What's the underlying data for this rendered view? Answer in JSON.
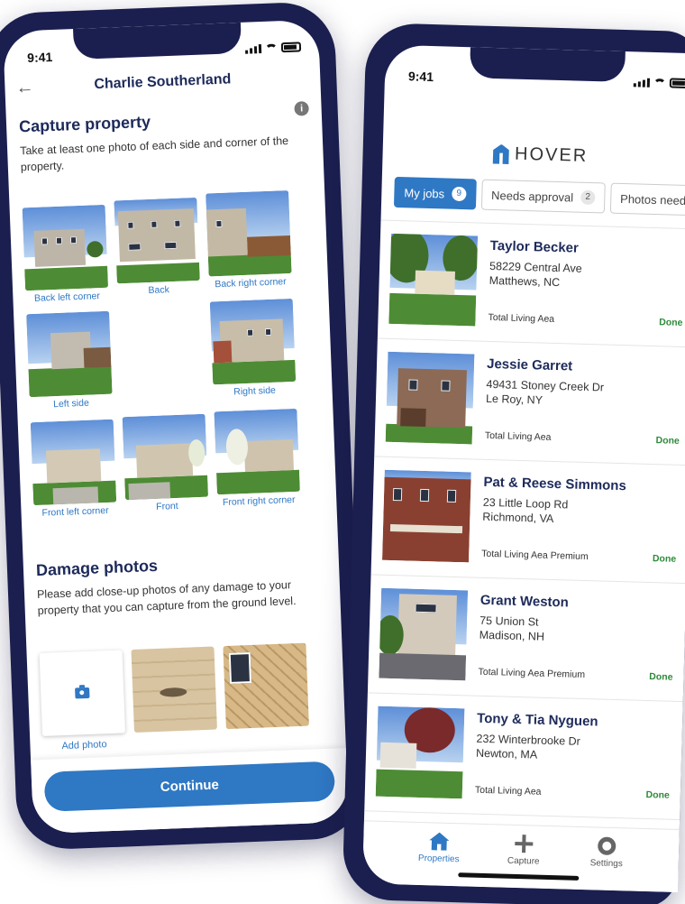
{
  "left_phone": {
    "status_time": "9:41",
    "header_name": "Charlie Southerland",
    "capture": {
      "title": "Capture property",
      "description": "Take at least one photo of each side and corner of the property.",
      "photos": [
        {
          "label": "Back left corner"
        },
        {
          "label": "Back"
        },
        {
          "label": "Back right corner"
        },
        {
          "label": "Left side"
        },
        {
          "label": "Right side"
        },
        {
          "label": "Front left corner"
        },
        {
          "label": "Front"
        },
        {
          "label": "Front right corner"
        }
      ]
    },
    "damage": {
      "title": "Damage photos",
      "description": "Please add close-up photos of any damage to your property that you can capture from the ground level.",
      "add_label": "Add photo"
    },
    "continue_label": "Continue"
  },
  "right_phone": {
    "status_time": "9:41",
    "logo_text": "HOVER",
    "tabs": [
      {
        "label": "My jobs",
        "count": "9"
      },
      {
        "label": "Needs approval",
        "count": "2"
      },
      {
        "label": "Photos needed",
        "count": ""
      }
    ],
    "jobs": [
      {
        "name": "Taylor Becker",
        "street": "58229 Central Ave",
        "city": "Matthews, NC",
        "area": "Total Living Aea",
        "status": "Done"
      },
      {
        "name": "Jessie Garret",
        "street": "49431 Stoney Creek Dr",
        "city": "Le Roy, NY",
        "area": "Total Living Aea",
        "status": "Done"
      },
      {
        "name": "Pat & Reese Simmons",
        "street": "23 Little Loop Rd",
        "city": "Richmond, VA",
        "area": "Total Living Aea Premium",
        "status": "Done"
      },
      {
        "name": "Grant Weston",
        "street": "75 Union St",
        "city": "Madison, NH",
        "area": "Total Living Aea Premium",
        "status": "Done"
      },
      {
        "name": "Tony & Tia Nyguen",
        "street": "232 Winterbrooke Dr",
        "city": "Newton, MA",
        "area": "Total Living Aea",
        "status": "Done"
      }
    ],
    "tabbar": [
      {
        "label": "Properties"
      },
      {
        "label": "Capture"
      },
      {
        "label": "Settings"
      }
    ]
  },
  "colors": {
    "brand_blue": "#2f78c4",
    "phone_frame": "#1b1f4f",
    "heading": "#1d2a5a",
    "done_green": "#2e8b3a"
  }
}
